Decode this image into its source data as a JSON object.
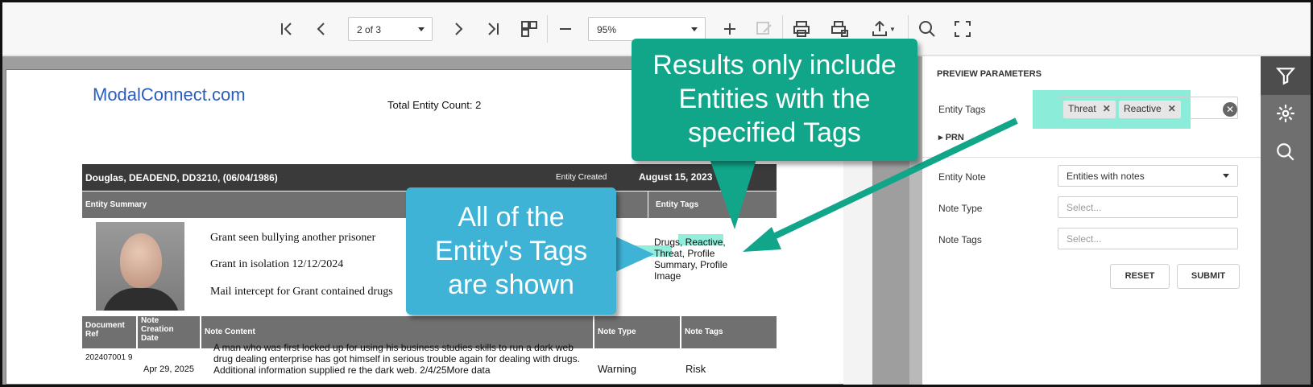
{
  "toolbar": {
    "page_select": "2 of 3",
    "zoom_select": "95%",
    "icons": [
      "first-page-icon",
      "prev-page-icon",
      "next-page-icon",
      "last-page-icon",
      "multipage-icon",
      "zoom-out-icon",
      "zoom-in-icon",
      "edit-icon",
      "print-icon",
      "print-page-icon",
      "export-icon",
      "search-icon",
      "fullscreen-icon"
    ]
  },
  "report": {
    "logo": "ModalConnect.com",
    "entity_count": "Total Entity Count: 2",
    "entity_header": "Douglas, DEADEND, DD3210, (06/04/1986)",
    "entity_created_label": "Entity Created",
    "entity_created_date": "August 15, 2023",
    "summary_header": "Entity Summary",
    "tags_header": "Entity Tags",
    "notes": [
      "Grant seen bullying  another prisoner",
      "Grant in isolation  12/12/2024",
      "Mail intercept for Grant contained  drugs"
    ],
    "entity_tags": "Drugs, Reactive, Threat, Profile Summary, Profile Image",
    "table": {
      "headers": [
        "Document Ref",
        "Note Creation Date",
        "Note Content",
        "Note Type",
        "Note Tags"
      ],
      "row": {
        "doc_ref": "202407001 9",
        "date": "Apr 29, 2025",
        "content": "A man who was first locked up for using his business studies skills to run a dark web drug dealing enterprise has got himself in serious trouble again for dealing with drugs. Additional information supplied re the dark web. 2/4/25More data",
        "type": "Warning",
        "tags": "Risk"
      }
    }
  },
  "panel": {
    "title": "PREVIEW PARAMETERS",
    "entity_tags_label": "Entity Tags",
    "chips": [
      "Threat",
      "Reactive"
    ],
    "collapsed_section": "PRN",
    "entity_note_label": "Entity Note",
    "entity_note_value": "Entities with notes",
    "note_type_label": "Note Type",
    "note_type_placeholder": "Select...",
    "note_tags_label": "Note Tags",
    "note_tags_placeholder": "Select...",
    "reset_label": "RESET",
    "submit_label": "SUBMIT"
  },
  "rail": {
    "icons": [
      "filter-icon",
      "gear-icon",
      "search-icon"
    ]
  },
  "callouts": {
    "top": [
      "Results only include",
      "Entities with the",
      "specified Tags"
    ],
    "left": [
      "All of the",
      "Entity's Tags",
      "are shown"
    ]
  },
  "colors": {
    "callout_green": "#11a58a",
    "callout_blue": "#3fb3d6",
    "highlight": "#6ee8cf"
  }
}
